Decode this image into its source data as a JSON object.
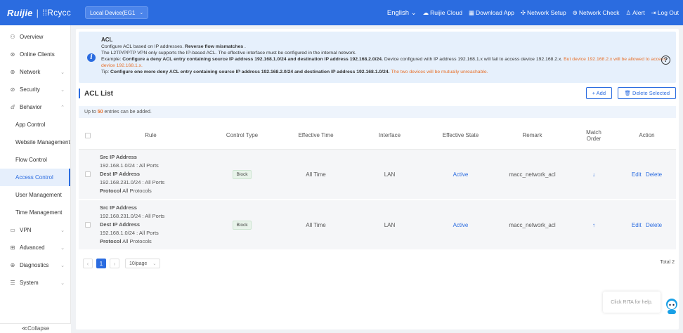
{
  "topbar": {
    "logo_main": "Ruijie",
    "logo_sub": "Rcycc",
    "device": "Local Device(EG1",
    "nav": [
      {
        "icon": "globe-icon",
        "label": "English ⌄"
      },
      {
        "icon": "cloud-icon",
        "label": "Ruijie Cloud"
      },
      {
        "icon": "qr-icon",
        "label": "Download App"
      },
      {
        "icon": "network-setup-icon",
        "label": "Network Setup"
      },
      {
        "icon": "network-check-icon",
        "label": "Network Check"
      },
      {
        "icon": "alert-icon",
        "label": "Alert"
      },
      {
        "icon": "logout-icon",
        "label": "Log Out"
      }
    ]
  },
  "sidebar": {
    "items": [
      {
        "label": "Overview",
        "icon": "overview-icon",
        "glyph": "⚇"
      },
      {
        "label": "Online Clients",
        "icon": "clients-icon",
        "glyph": "⊛"
      },
      {
        "label": "Network",
        "icon": "network-icon",
        "glyph": "⊕"
      },
      {
        "label": "Security",
        "icon": "security-icon",
        "glyph": "⊘"
      },
      {
        "label": "Behavior",
        "icon": "behavior-icon",
        "glyph": "ⅆ"
      }
    ],
    "behavior_sub": [
      "App Control",
      "Website Management",
      "Flow Control",
      "Access Control",
      "User Management",
      "Time Management"
    ],
    "items_after": [
      {
        "label": "VPN",
        "icon": "vpn-icon",
        "glyph": "▭"
      },
      {
        "label": "Advanced",
        "icon": "advanced-icon",
        "glyph": "⊞"
      },
      {
        "label": "Diagnostics",
        "icon": "diagnostics-icon",
        "glyph": "⊕"
      },
      {
        "label": "System",
        "icon": "system-icon",
        "glyph": "☰"
      }
    ],
    "collapse": "≪Collapse"
  },
  "info": {
    "title": "ACL",
    "line1_a": "Configure ACL based on IP addresses. ",
    "line1_b": "Reverse flow mismatches",
    "line1_c": " .",
    "line2": "The L2TP/PPTP VPN only supports the IP-based ACL. The effective interface must be configured in the internal network.",
    "line3_a": "Example: ",
    "line3_b": "Configure a deny ACL entry containing source IP address 192.168.1.0/24 and destination IP address 192.168.2.0/24.",
    "line3_c": " Device configured with IP address 192.168.1.x will fail to access device 192.168.2.x. ",
    "line3_d": "But device 192.168.2.x will be allowed to access device 192.168.1.x.",
    "line4_a": "Tip: ",
    "line4_b": "Configure one more deny ACL entry containing source IP address 192.168.2.0/24 and destination IP address 192.168.1.0/24.",
    "line4_c": " The two devices will be mutually unreachable."
  },
  "acl": {
    "title": "ACL List",
    "add": "+ Add",
    "delete_selected": "🗑 Delete Selected",
    "limit_pre": "Up to",
    "limit_num": "50",
    "limit_post": "entries can be added."
  },
  "table": {
    "headers": {
      "rule": "Rule",
      "control_type": "Control Type",
      "effective_time": "Effective Time",
      "interface": "Interface",
      "effective_state": "Effective State",
      "remark": "Remark",
      "match_order_1": "Match",
      "match_order_2": "Order",
      "action": "Action"
    },
    "rows": [
      {
        "src_label": "Src IP Address",
        "src_val": "192.168.1.0/24 : All Ports",
        "dst_label": "Dest IP Address",
        "dst_val": "192.168.231.0/24 : All Ports",
        "proto_label": "Protocol",
        "proto_val": "All Protocols",
        "control": "Block",
        "time": "All Time",
        "interface": "LAN",
        "state": "Active",
        "remark": "macc_network_acl",
        "order": "↓",
        "edit": "Edit",
        "delete": "Delete"
      },
      {
        "src_label": "Src IP Address",
        "src_val": "192.168.231.0/24 : All Ports",
        "dst_label": "Dest IP Address",
        "dst_val": "192.168.1.0/24 : All Ports",
        "proto_label": "Protocol",
        "proto_val": "All Protocols",
        "control": "Block",
        "time": "All Time",
        "interface": "LAN",
        "state": "Active",
        "remark": "macc_network_acl",
        "order": "↑",
        "edit": "Edit",
        "delete": "Delete"
      }
    ]
  },
  "pager": {
    "prev": "‹",
    "current": "1",
    "next": "›",
    "size": "10/page",
    "total": "Total 2"
  },
  "rita": "Click RITA for help.",
  "colors": {
    "primary": "#2b6ce0",
    "warn": "#e8702a"
  }
}
